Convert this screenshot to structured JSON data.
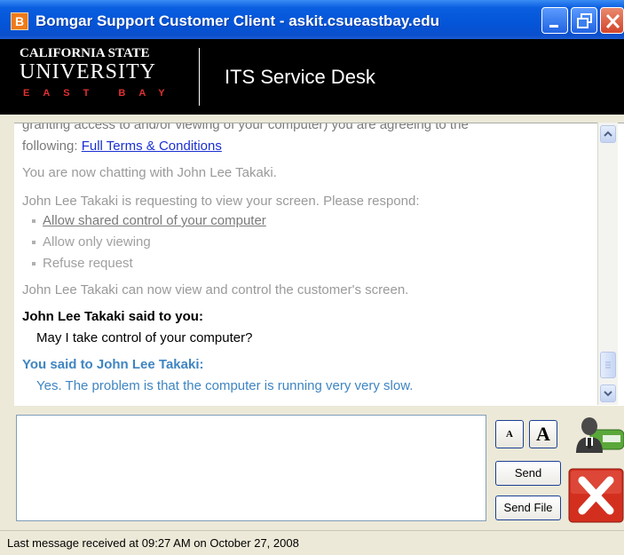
{
  "window": {
    "title": "Bomgar Support Customer Client - askit.csueastbay.edu",
    "app_icon_letter": "B"
  },
  "banner": {
    "logo_line1": "CALIFORNIA STATE",
    "logo_line2": "UNIVERSITY",
    "logo_line3": "EAST BAY",
    "title": "ITS Service Desk"
  },
  "chat": {
    "clipped_line": "granting access to and/or viewing of your computer) you are agreeing to the",
    "terms_prefix": "following:",
    "terms_link": "Full Terms & Conditions",
    "now_chatting": "You are now chatting with John Lee Takaki.",
    "request_text": "John Lee Takaki is requesting to view your screen.  Please respond:",
    "options": [
      "Allow shared control of your computer",
      "Allow only viewing",
      "Refuse request"
    ],
    "control_notice": "John Lee Takaki can now view and control the customer's screen.",
    "agent_header": "John Lee Takaki said to you:",
    "agent_message": "May I take control of your computer?",
    "you_header": "You said to John Lee Takaki:",
    "you_message": "Yes. The problem is that the computer is running very very slow."
  },
  "input": {
    "value": "",
    "placeholder": ""
  },
  "buttons": {
    "font_smaller": "A",
    "font_larger": "A",
    "send": "Send",
    "send_file": "Send File"
  },
  "icons": {
    "agent": "support-agent-icon",
    "end_session": "close-x-icon"
  },
  "colors": {
    "titlebar": "#0455d8",
    "link": "#1a2fd1",
    "you_message": "#3f85c2",
    "end_button": "#d32f1f"
  },
  "status": {
    "text": "Last message received at 09:27 AM on October 27, 2008"
  }
}
